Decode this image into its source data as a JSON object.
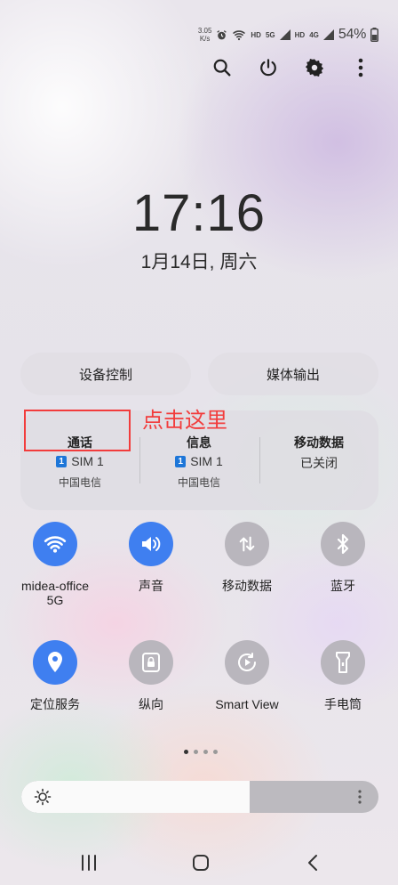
{
  "status_bar": {
    "speed_value": "3.05",
    "speed_unit": "K/s",
    "net1": "HD",
    "net2_gen": "5G",
    "net2": "HD",
    "net3_gen": "4G",
    "battery": "54%",
    "icons": [
      "alarm-icon",
      "wifi-icon",
      "signal-icon",
      "signal-icon",
      "battery-icon"
    ]
  },
  "top_actions": [
    "search-icon",
    "power-icon",
    "gear-icon",
    "more-vertical-icon"
  ],
  "clock": {
    "time": "17:16",
    "date": "1月14日, 周六"
  },
  "pills": {
    "device_control": "设备控制",
    "media_output": "媒体输出"
  },
  "sim_card": {
    "calls": {
      "title": "通话",
      "sim": "SIM 1",
      "carrier": "中国电信",
      "badge": "1"
    },
    "messages": {
      "title": "信息",
      "sim": "SIM 1",
      "carrier": "中国电信",
      "badge": "1"
    },
    "mobile_data": {
      "title": "移动数据",
      "status": "已关闭"
    }
  },
  "annotation": {
    "text": "点击这里",
    "color": "#f23c3c"
  },
  "toggles": {
    "wifi": {
      "label": "midea-office",
      "sub": "5G",
      "on": true,
      "icon": "wifi-icon"
    },
    "sound": {
      "label": "声音",
      "on": true,
      "icon": "speaker-icon"
    },
    "mobile_data": {
      "label": "移动数据",
      "on": false,
      "icon": "data-arrows-icon"
    },
    "bluetooth": {
      "label": "蓝牙",
      "on": false,
      "icon": "bluetooth-icon"
    },
    "location": {
      "label": "定位服务",
      "on": true,
      "icon": "location-pin-icon"
    },
    "portrait": {
      "label": "纵向",
      "on": false,
      "icon": "rotation-lock-icon"
    },
    "smart_view": {
      "label": "Smart View",
      "on": false,
      "icon": "smart-view-icon"
    },
    "flashlight": {
      "label": "手电筒",
      "on": false,
      "icon": "flashlight-icon"
    }
  },
  "pager": {
    "pages": 4,
    "current": 1
  },
  "brightness": {
    "level": 0.64
  },
  "nav_bar": [
    "recents-icon",
    "home-icon",
    "back-icon"
  ],
  "colors": {
    "accent": "#3f7ff0",
    "inactive": "#b9b6bd",
    "sim_badge": "#1d76d8"
  }
}
